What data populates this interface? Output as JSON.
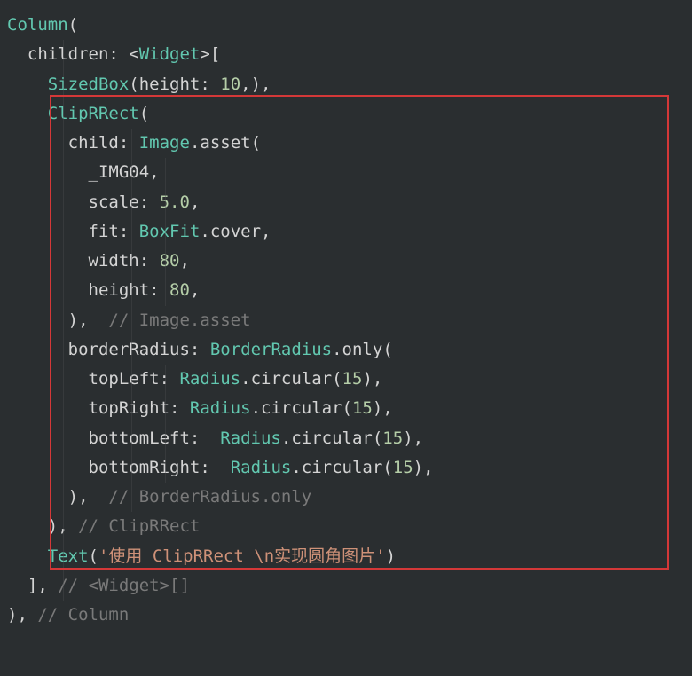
{
  "code": {
    "l1_column": "Column",
    "l2_children": "children",
    "l2_widget": "Widget",
    "l3_sizedbox": "SizedBox",
    "l3_height": "height",
    "l3_heightval": "10",
    "l4_cliprrect": "ClipRRect",
    "l5_child": "child",
    "l5_image": "Image",
    "l5_asset": "asset",
    "l6_img": "_IMG04",
    "l7_scale": "scale",
    "l7_scaleval": "5.0",
    "l8_fit": "fit",
    "l8_boxfit": "BoxFit",
    "l8_cover": "cover",
    "l9_width": "width",
    "l9_widthval": "80",
    "l10_height": "height",
    "l10_heightval": "80",
    "l11_cmt": "// Image.asset",
    "l12_borderradius": "borderRadius",
    "l12_br": "BorderRadius",
    "l12_only": "only",
    "l13_topleft": "topLeft",
    "l13_radius": "Radius",
    "l13_circular": "circular",
    "l13_val": "15",
    "l14_topright": "topRight",
    "l14_val": "15",
    "l15_bottomleft": "bottomLeft",
    "l15_val": "15",
    "l16_bottomright": "bottomRight",
    "l16_val": "15",
    "l17_cmt": "// BorderRadius.only",
    "l18_cmt": "// ClipRRect",
    "l19_text": "Text",
    "l19_str": "'使用 ClipRRect \\n实现圆角图片'",
    "l20_cmt": "// <Widget>[]",
    "l21_cmt": "// Column"
  }
}
